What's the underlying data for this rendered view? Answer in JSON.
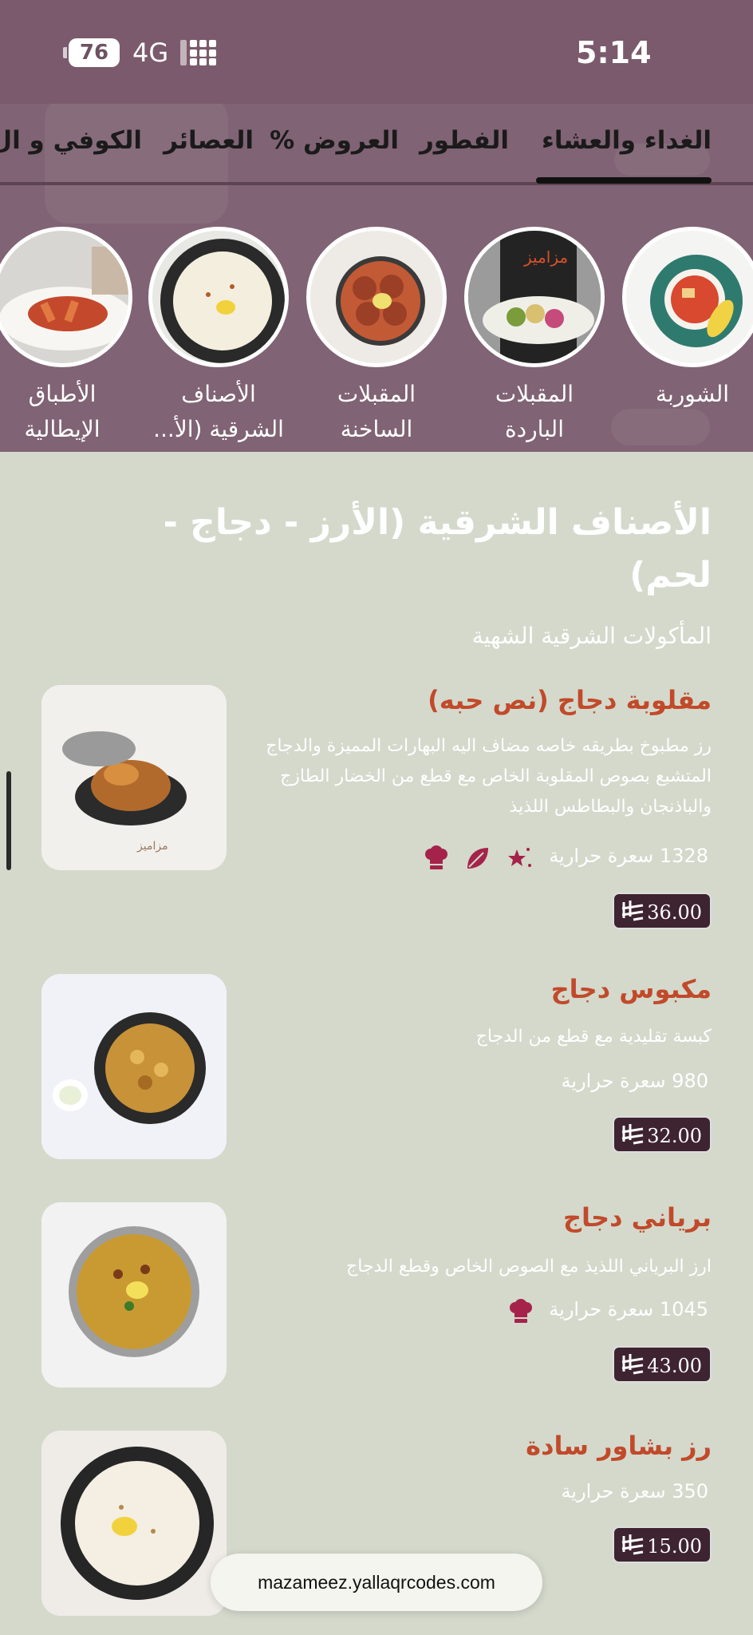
{
  "status_bar": {
    "battery": "76",
    "network": "4G",
    "time": "5:14"
  },
  "tabs": [
    {
      "label": "الغداء والعشاء",
      "active": true
    },
    {
      "label": "الفطور",
      "active": false
    },
    {
      "label": "العروض %",
      "active": false
    },
    {
      "label": "العصائر",
      "active": false
    },
    {
      "label": "الكوفي و ال",
      "active": false
    }
  ],
  "categories": [
    {
      "label": "الشوربة",
      "label2": ""
    },
    {
      "label": "المقبلات",
      "label2": "الباردة"
    },
    {
      "label": "المقبلات",
      "label2": "الساخنة"
    },
    {
      "label": "الأصناف",
      "label2": "الشرقية (الأ..."
    },
    {
      "label": "الأطباق",
      "label2": "الإيطالية"
    }
  ],
  "section": {
    "title": "الأصناف الشرقية (الأرز - دجاج - لحم)",
    "subtitle": "المأكولات الشرقية الشهية"
  },
  "items": [
    {
      "name": "مقلوبة دجاج (نص حبه)",
      "description": "رز مطبوخ بطريقه خاصه مضاف اليه البهارات المميزة والدجاج المتشبع بصوص المقلوبة الخاص مع قطع من الخضار الطازج والباذنجان والبطاطس اللذيذ",
      "calories": "1328 سعرة حرارية",
      "price": "36.00",
      "icons": [
        "chef-hat-icon",
        "leaf-icon",
        "stars-icon"
      ]
    },
    {
      "name": "مكبوس دجاج",
      "description": "كبسة تقليدية مع قطع من الدجاج",
      "calories": "980 سعرة حرارية",
      "price": "32.00",
      "icons": []
    },
    {
      "name": "برياني دجاج",
      "description": "ارز البرياني  اللذيذ مع الصوص الخاص وقطع الدجاج",
      "calories": "1045 سعرة حرارية",
      "price": "43.00",
      "icons": [
        "chef-hat-icon"
      ]
    },
    {
      "name": "رز بشاور سادة",
      "description": "",
      "calories": "350 سعرة حرارية",
      "price": "15.00",
      "icons": []
    }
  ],
  "url": "mazameez.yallaqrcodes.com",
  "colors": {
    "header": "#806374",
    "background": "#d4d9cc",
    "item_name": "#c14a2a",
    "price_bg": "#3e2330",
    "icon_accent": "#a5234a"
  }
}
